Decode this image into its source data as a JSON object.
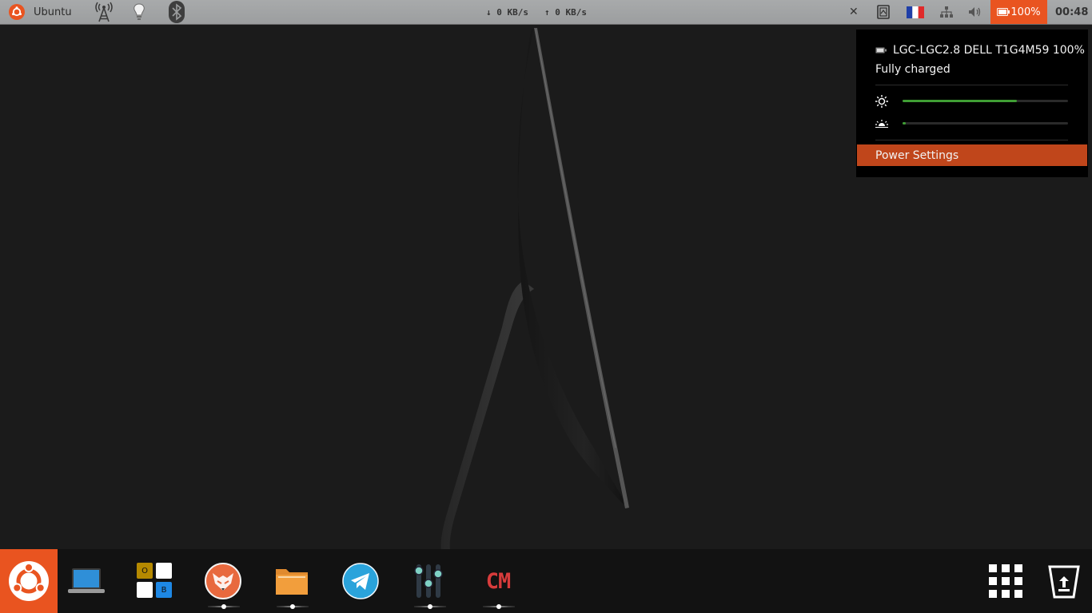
{
  "top_panel": {
    "app_label": "Ubuntu",
    "net_down": "↓ 0 KB/s",
    "net_up": "↑ 0 KB/s",
    "close_glyph": "✕",
    "battery_label": "100%",
    "clock": "00:48",
    "accent_color": "#e95420",
    "icons": [
      "ubuntu-logo-icon",
      "wifi-hotspot-icon",
      "lightbulb-icon",
      "bluetooth-icon",
      "close-icon",
      "clipboard-icon",
      "france-flag-icon",
      "network-icon",
      "volume-icon",
      "battery-icon"
    ]
  },
  "battery_menu": {
    "device": "LGC-LGC2.8 DELL T1G4M59 100%",
    "status": "Fully charged",
    "screen_brightness_level": 0.69,
    "keyboard_brightness_level": 0.02,
    "action_label": "Power Settings",
    "slider_color": "#3f9e34",
    "highlight_color": "#c0461b"
  },
  "dock": {
    "items": [
      {
        "name": "ubuntu-home",
        "icon": "ubuntu-logo-icon",
        "running": false
      },
      {
        "name": "laptop-app",
        "icon": "laptop-icon",
        "running": false
      },
      {
        "name": "office-app",
        "icon": "office-grid-icon",
        "running": false,
        "tiles": [
          "O",
          "",
          "",
          "B"
        ]
      },
      {
        "name": "fox-app",
        "icon": "fox-icon",
        "running": true
      },
      {
        "name": "files-app",
        "icon": "folder-icon",
        "running": true
      },
      {
        "name": "telegram-app",
        "icon": "telegram-icon",
        "running": false
      },
      {
        "name": "mixer-app",
        "icon": "equalizer-icon",
        "running": true
      },
      {
        "name": "cm-app",
        "icon": "cm-icon",
        "running": true,
        "label": "CM"
      },
      {
        "name": "app-grid",
        "icon": "app-grid-icon",
        "running": false
      },
      {
        "name": "trash",
        "icon": "trash-icon",
        "running": false
      }
    ]
  }
}
